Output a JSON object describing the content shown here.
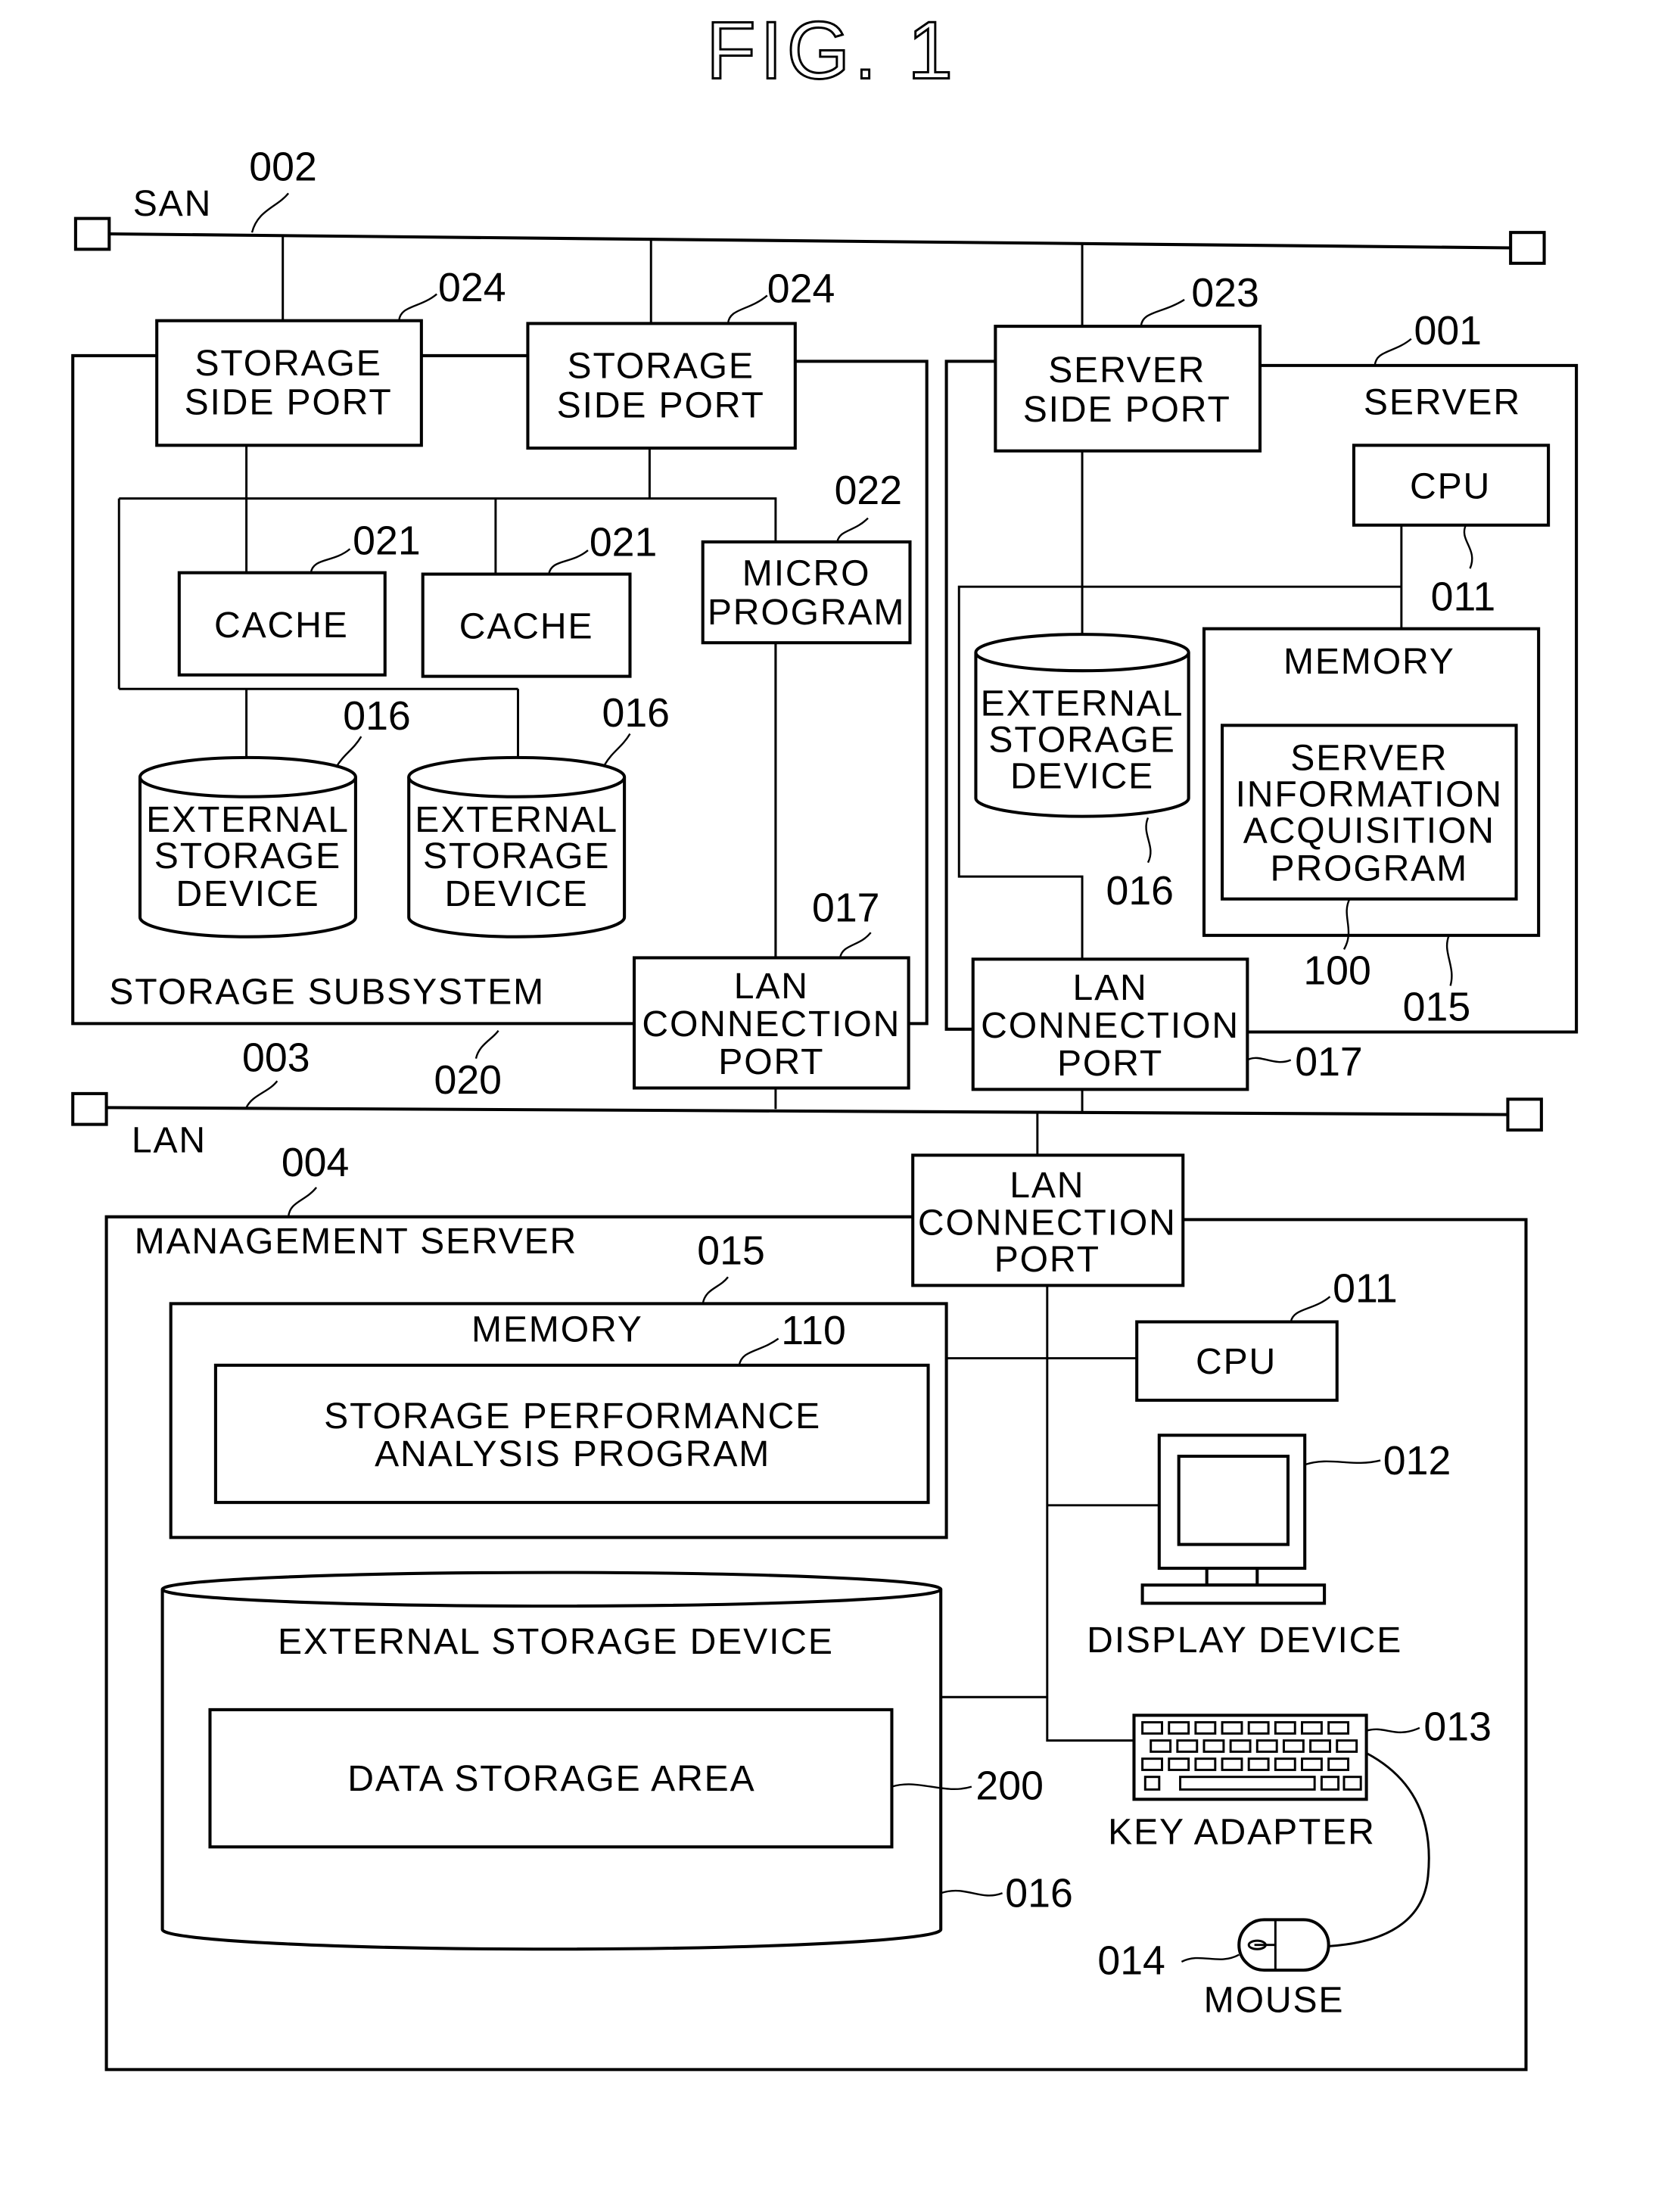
{
  "figure": {
    "title": "FIG. 1"
  },
  "networks": {
    "san": {
      "label": "SAN",
      "ref": "002"
    },
    "lan": {
      "label": "LAN",
      "ref": "003"
    }
  },
  "storage_subsystem": {
    "label": "STORAGE SUBSYSTEM",
    "ref": "020",
    "ports": [
      {
        "lines": [
          "STORAGE",
          "SIDE PORT"
        ],
        "ref": "024"
      },
      {
        "lines": [
          "STORAGE",
          "SIDE PORT"
        ],
        "ref": "024"
      }
    ],
    "caches": [
      {
        "label": "CACHE",
        "ref": "021"
      },
      {
        "label": "CACHE",
        "ref": "021"
      }
    ],
    "micro_program": {
      "lines": [
        "MICRO",
        "PROGRAM"
      ],
      "ref": "022"
    },
    "disks": [
      {
        "lines": [
          "EXTERNAL",
          "STORAGE",
          "DEVICE"
        ],
        "ref": "016"
      },
      {
        "lines": [
          "EXTERNAL",
          "STORAGE",
          "DEVICE"
        ],
        "ref": "016"
      }
    ],
    "lan_port": {
      "lines": [
        "LAN",
        "CONNECTION",
        "PORT"
      ],
      "ref": "017"
    }
  },
  "server": {
    "label": "SERVER",
    "ref": "001",
    "port": {
      "lines": [
        "SERVER",
        "SIDE PORT"
      ],
      "ref": "023"
    },
    "cpu": {
      "label": "CPU",
      "ref": "011"
    },
    "disk": {
      "lines": [
        "EXTERNAL",
        "STORAGE",
        "DEVICE"
      ],
      "ref": "016"
    },
    "memory": {
      "label": "MEMORY",
      "ref": "015"
    },
    "program": {
      "lines": [
        "SERVER",
        "INFORMATION",
        "ACQUISITION",
        "PROGRAM"
      ],
      "ref": "100"
    },
    "lan_port": {
      "lines": [
        "LAN",
        "CONNECTION",
        "PORT"
      ],
      "ref": "017"
    }
  },
  "management_server": {
    "label": "MANAGEMENT SERVER",
    "ref": "004",
    "lan_port": {
      "lines": [
        "LAN",
        "CONNECTION",
        "PORT"
      ]
    },
    "memory": {
      "label": "MEMORY",
      "ref": "015"
    },
    "program": {
      "lines": [
        "STORAGE PERFORMANCE",
        "ANALYSIS PROGRAM"
      ],
      "ref": "110"
    },
    "cpu": {
      "label": "CPU",
      "ref": "011"
    },
    "display": {
      "label": "DISPLAY DEVICE",
      "ref": "012"
    },
    "external_storage": {
      "label": "EXTERNAL STORAGE DEVICE",
      "ref": "016"
    },
    "data_area": {
      "label": "DATA STORAGE AREA",
      "ref": "200"
    },
    "keyboard": {
      "label": "KEY ADAPTER",
      "ref": "013"
    },
    "mouse": {
      "label": "MOUSE",
      "ref": "014"
    }
  }
}
